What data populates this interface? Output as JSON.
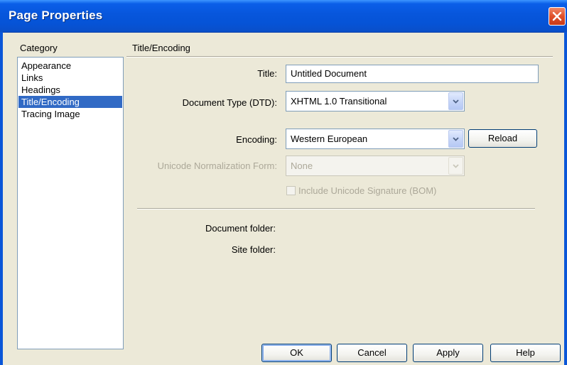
{
  "window": {
    "title": "Page Properties"
  },
  "category": {
    "label": "Category",
    "items": [
      {
        "label": "Appearance"
      },
      {
        "label": "Links"
      },
      {
        "label": "Headings"
      },
      {
        "label": "Title/Encoding"
      },
      {
        "label": "Tracing Image"
      }
    ],
    "selected_index": 3
  },
  "section": {
    "title": "Title/Encoding"
  },
  "form": {
    "title_label": "Title:",
    "title_value": "Untitled Document",
    "doctype_label": "Document Type (DTD):",
    "doctype_value": "XHTML 1.0 Transitional",
    "encoding_label": "Encoding:",
    "encoding_value": "Western European",
    "reload_label": "Reload",
    "normalization_label": "Unicode Normalization Form:",
    "normalization_value": "None",
    "bom_label": "Include Unicode Signature (BOM)",
    "document_folder_label": "Document folder:",
    "site_folder_label": "Site folder:"
  },
  "buttons": {
    "ok": "OK",
    "cancel": "Cancel",
    "apply": "Apply",
    "help": "Help"
  },
  "icons": {
    "close": "close-icon",
    "dropdown": "chevron-down-icon"
  },
  "colors": {
    "titlebar": "#0756dc",
    "selection": "#316ac5",
    "close_button": "#e0502a",
    "dialog_background": "#ece9d8"
  }
}
